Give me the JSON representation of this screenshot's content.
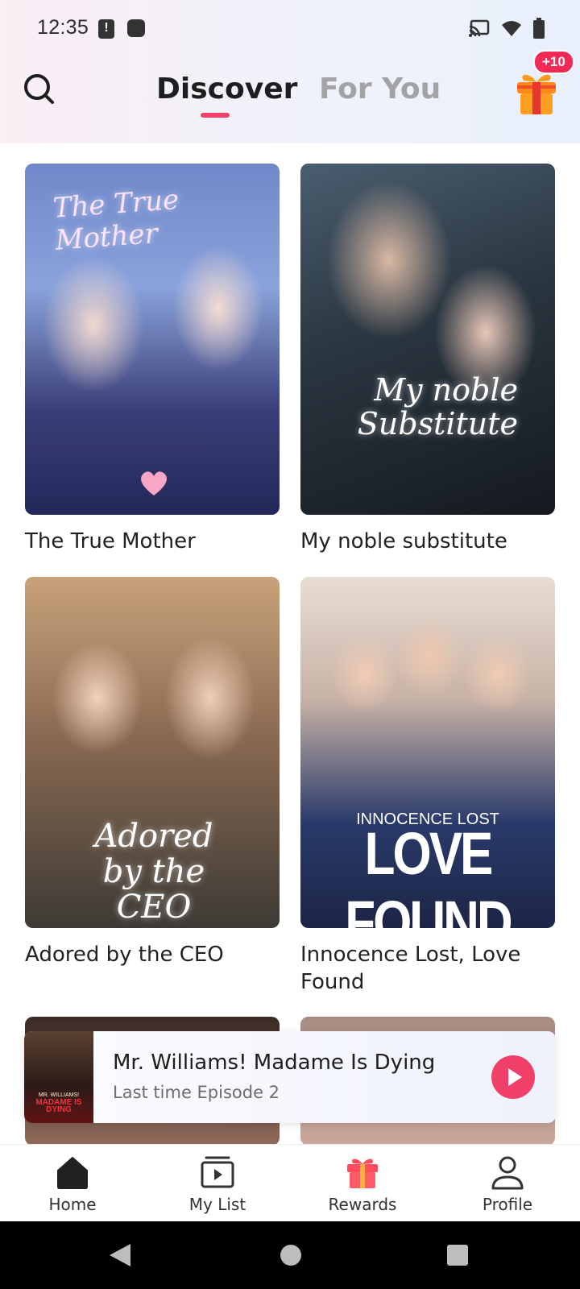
{
  "status_bar": {
    "time": "12:35",
    "icons": [
      "notification-alert-icon",
      "app-dot-icon",
      "cast-icon",
      "wifi-icon",
      "battery-icon"
    ]
  },
  "header": {
    "tabs": [
      {
        "label": "Discover",
        "active": true
      },
      {
        "label": "For You",
        "active": false
      }
    ],
    "reward_badge": "+10",
    "accent_color": "#f0406a"
  },
  "dramas": [
    {
      "title": "The True Mother",
      "poster_art": "The True Mother"
    },
    {
      "title": "My noble substitute",
      "poster_art": "My noble Substitute"
    },
    {
      "title": "Adored by the CEO",
      "poster_art": "Adored by the CEO"
    },
    {
      "title": "Innocence Lost, Love Found",
      "poster_art_top": "INNOCENCE LOST",
      "poster_art_bottom": "LOVE FOUND"
    },
    {
      "title": ""
    },
    {
      "title": ""
    }
  ],
  "continue_watching": {
    "title": "Mr. Williams! Madame Is Dying",
    "subtitle": "Last time Episode 2",
    "thumb_text_top": "MR. WILLIAMS!",
    "thumb_text_bottom": "MADAME IS DYING"
  },
  "bottom_nav": [
    {
      "label": "Home",
      "icon": "home-icon",
      "active": true
    },
    {
      "label": "My List",
      "icon": "playlist-icon",
      "active": false
    },
    {
      "label": "Rewards",
      "icon": "gift-icon",
      "active": false
    },
    {
      "label": "Profile",
      "icon": "user-icon",
      "active": false
    }
  ]
}
